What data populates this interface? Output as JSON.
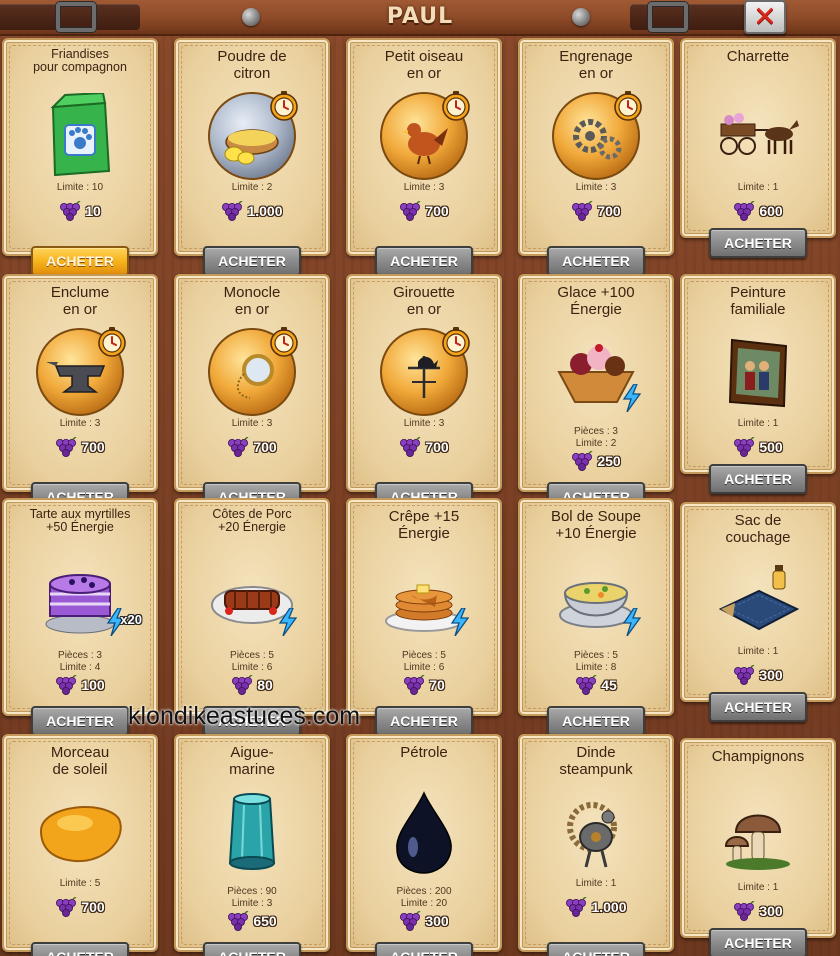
{
  "header": {
    "title": "PAUL",
    "close_icon": "close-x-icon"
  },
  "colors": {
    "accent": "#f6b41d",
    "panel": "#ecd6a8",
    "button": "#8b8b8b",
    "close": "#d8261a",
    "background": "#7a3f24"
  },
  "currency_icon": "grapes-icon",
  "buy_label": "ACHETER",
  "watermark": "klondikeastuces.com",
  "items": [
    {
      "name": "Friandises\npour compagnon",
      "icon": "pet-treats-bag-icon",
      "lines": [
        "Limite : 10"
      ],
      "price": "10",
      "active": true
    },
    {
      "name": "Poudre de\ncitron",
      "icon": "lemon-powder-icon",
      "lines": [
        "Limite : 2"
      ],
      "price": "1.000"
    },
    {
      "name": "Petit oiseau\nen or",
      "icon": "golden-bird-icon",
      "lines": [
        "Limite : 3"
      ],
      "price": "700"
    },
    {
      "name": "Engrenage\nen or",
      "icon": "golden-gear-icon",
      "lines": [
        "Limite : 3"
      ],
      "price": "700"
    },
    {
      "name": "Charrette",
      "icon": "cart-icon",
      "lines": [
        "Limite : 1"
      ],
      "price": "600"
    },
    {
      "name": "Enclume\nen or",
      "icon": "golden-anvil-icon",
      "lines": [
        "Limite : 3"
      ],
      "price": "700"
    },
    {
      "name": "Monocle\nen or",
      "icon": "golden-monocle-icon",
      "lines": [
        "Limite : 3"
      ],
      "price": "700"
    },
    {
      "name": "Girouette\nen or",
      "icon": "golden-weathervane-icon",
      "lines": [
        "Limite : 3"
      ],
      "price": "700"
    },
    {
      "name": "Glace +100\nÉnergie",
      "icon": "ice-cream-basket-icon",
      "lines": [
        "Pièces : 3",
        "Limite : 2"
      ],
      "price": "250"
    },
    {
      "name": "Peinture\nfamiliale",
      "icon": "family-painting-icon",
      "lines": [
        "Limite : 1"
      ],
      "price": "500"
    },
    {
      "name": "Tarte aux myrtilles\n+50 Énergie",
      "icon": "blueberry-cake-icon",
      "lines": [
        "Pièces : 3",
        "Limite : 4"
      ],
      "price": "100",
      "multiplier": "x20"
    },
    {
      "name": "Côtes de Porc\n+20 Énergie",
      "icon": "pork-ribs-icon",
      "lines": [
        "Pièces : 5",
        "Limite : 6"
      ],
      "price": "80"
    },
    {
      "name": "Crêpe +15\nÉnergie",
      "icon": "pancakes-icon",
      "lines": [
        "Pièces : 5",
        "Limite : 6"
      ],
      "price": "70"
    },
    {
      "name": "Bol de Soupe\n+10 Énergie",
      "icon": "soup-bowl-icon",
      "lines": [
        "Pièces : 5",
        "Limite : 8"
      ],
      "price": "45"
    },
    {
      "name": "Sac de\ncouchage",
      "icon": "sleeping-bag-icon",
      "lines": [
        "Limite : 1"
      ],
      "price": "300"
    },
    {
      "name": "Morceau\nde soleil",
      "icon": "amber-stone-icon",
      "lines": [
        "Limite : 5"
      ],
      "price": "700"
    },
    {
      "name": "Aigue-\nmarine",
      "icon": "aquamarine-crystal-icon",
      "lines": [
        "Pièces : 90",
        "Limite : 3"
      ],
      "price": "650"
    },
    {
      "name": "Pétrole",
      "icon": "oil-drop-icon",
      "lines": [
        "Pièces : 200",
        "Limite : 20"
      ],
      "price": "300"
    },
    {
      "name": "Dinde\nsteampunk",
      "icon": "steampunk-turkey-icon",
      "lines": [
        "Limite : 1"
      ],
      "price": "1.000"
    },
    {
      "name": "Champignons",
      "icon": "mushrooms-icon",
      "lines": [
        "Limite : 1"
      ],
      "price": "300"
    }
  ]
}
